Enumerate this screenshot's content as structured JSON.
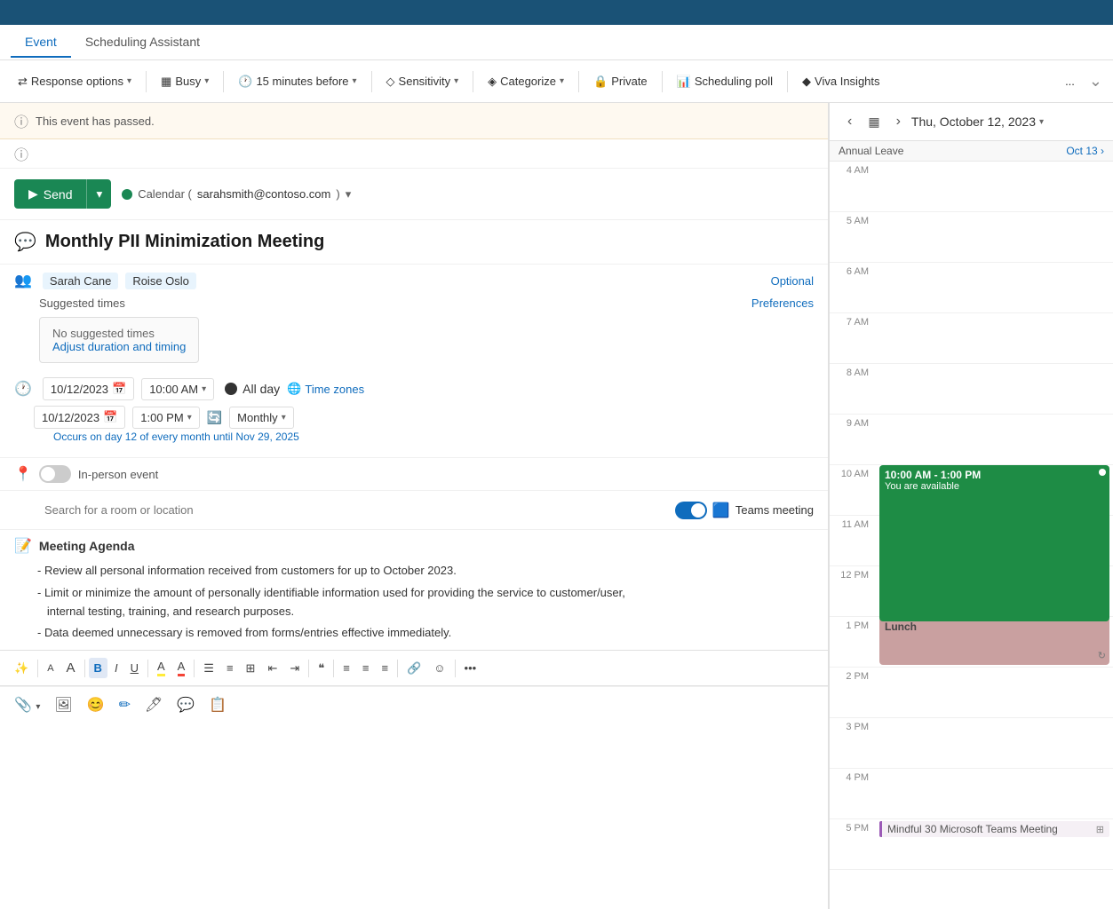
{
  "topbar": {},
  "tabs": {
    "event_label": "Event",
    "scheduling_assistant_label": "Scheduling Assistant"
  },
  "toolbar": {
    "response_options": "Response options",
    "busy": "Busy",
    "reminder": "15 minutes before",
    "sensitivity": "Sensitivity",
    "categorize": "Categorize",
    "private": "Private",
    "scheduling_poll": "Scheduling poll",
    "viva_insights": "Viva Insights",
    "more": "..."
  },
  "info": {
    "event_passed": "This event has passed."
  },
  "send_row": {
    "send_label": "Send",
    "calendar_prefix": "Calendar (",
    "calendar_email": "sarahsmith@contoso.com",
    "calendar_suffix": ")"
  },
  "event": {
    "title": "Monthly PII Minimization Meeting",
    "attendees": [
      "Sarah Cane",
      "Roise Oslo"
    ],
    "optional_label": "Optional",
    "suggested_times_label": "Suggested times",
    "preferences_label": "Preferences",
    "no_suggested_times": "No suggested times",
    "adjust_link": "Adjust duration and timing",
    "start_date": "10/12/2023",
    "start_time": "10:00 AM",
    "end_date": "10/12/2023",
    "end_time": "1:00 PM",
    "all_day_label": "All day",
    "timezone_label": "Time zones",
    "recurrence": "Monthly",
    "recurrence_note": "Occurs on day 12 of every month until Nov 29, 2025",
    "inperson_label": "In-person event",
    "location_placeholder": "Search for a room or location",
    "teams_label": "Teams meeting",
    "agenda_title": "Meeting Agenda",
    "agenda_items": [
      "- Review all personal information received from customers for up to October 2023.",
      "- Limit or minimize the amount of personally identifiable information used for providing the service to customer/user,\n   internal testing, training, and research purposes.",
      "- Data deemed unnecessary is removed from forms/entries effective immediately."
    ]
  },
  "formatting": {
    "magic": "✨",
    "font_decrease": "A",
    "font_increase": "A",
    "bold": "B",
    "italic": "I",
    "underline": "U",
    "highlight": "A",
    "font_color": "A",
    "align_left": "≡",
    "list_bullet": "≣",
    "indent_left": "⇤",
    "indent_right": "⇥",
    "quote": "❝",
    "align_center": "≡",
    "align_right": "≡",
    "align_justify": "≡",
    "link": "🔗",
    "emoji2": "☺",
    "more_fmt": "•••"
  },
  "insert": {
    "attach": "📎",
    "image": "🖼",
    "emoji": "😊",
    "highlight_btn": "✏",
    "pen": "🖊",
    "sticker": "💬",
    "forms": "📋"
  },
  "calendar": {
    "prev": "‹",
    "next": "›",
    "date_title": "Thu, October 12, 2023",
    "chevron": "▾",
    "annual_leave": "Annual Leave",
    "annual_leave_date": "Oct 13 ›",
    "time_slots": [
      {
        "time": "4 AM",
        "events": []
      },
      {
        "time": "5 AM",
        "events": []
      },
      {
        "time": "6 AM",
        "events": []
      },
      {
        "time": "7 AM",
        "events": []
      },
      {
        "time": "8 AM",
        "events": []
      },
      {
        "time": "9 AM",
        "events": []
      },
      {
        "time": "10 AM",
        "events": [
          {
            "type": "green",
            "title": "10:00 AM - 1:00 PM",
            "subtitle": "You are available"
          }
        ]
      },
      {
        "time": "11 AM",
        "events": []
      },
      {
        "time": "12 PM",
        "events": []
      },
      {
        "time": "1 PM",
        "events": [
          {
            "type": "pink",
            "title": "Lunch"
          }
        ]
      },
      {
        "time": "2 PM",
        "events": []
      },
      {
        "time": "3 PM",
        "events": []
      },
      {
        "time": "4 PM",
        "events": []
      },
      {
        "time": "5 PM",
        "events": [
          {
            "type": "mindful",
            "title": "Mindful 30 Microsoft Teams Meeting"
          }
        ]
      }
    ]
  }
}
